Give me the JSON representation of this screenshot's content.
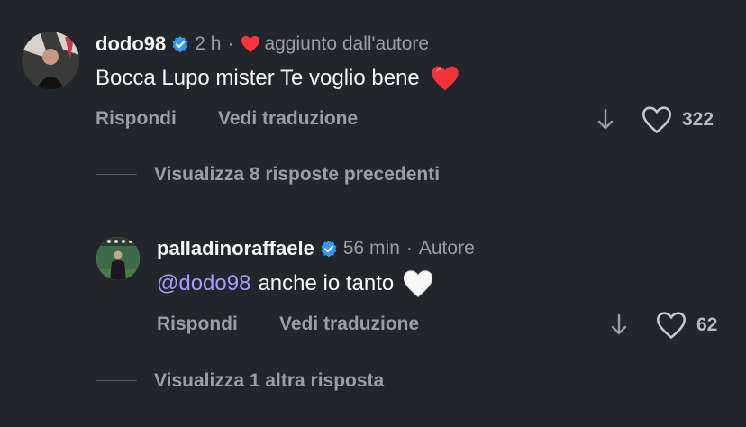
{
  "comment": {
    "username": "dodo98",
    "time": "2 h",
    "separator": "·",
    "liked_by_author": "aggiunto dall'autore",
    "text": "Bocca Lupo mister Te voglio bene",
    "emoji": "❤️",
    "reply_label": "Rispondi",
    "translate_label": "Vedi traduzione",
    "likes": "322"
  },
  "view_previous": "Visualizza 8 risposte precedenti",
  "reply": {
    "username": "palladinoraffaele",
    "time": "56 min",
    "separator": "·",
    "author_badge": "Autore",
    "mention": "@dodo98",
    "text": "anche io tanto",
    "emoji": "🤍",
    "reply_label": "Rispondi",
    "translate_label": "Vedi traduzione",
    "likes": "62"
  },
  "view_more": "Visualizza 1 altra risposta",
  "colors": {
    "background": "#222529",
    "verified": "#3897f0",
    "heart_red": "#ff3040",
    "mention": "#a89aff"
  }
}
